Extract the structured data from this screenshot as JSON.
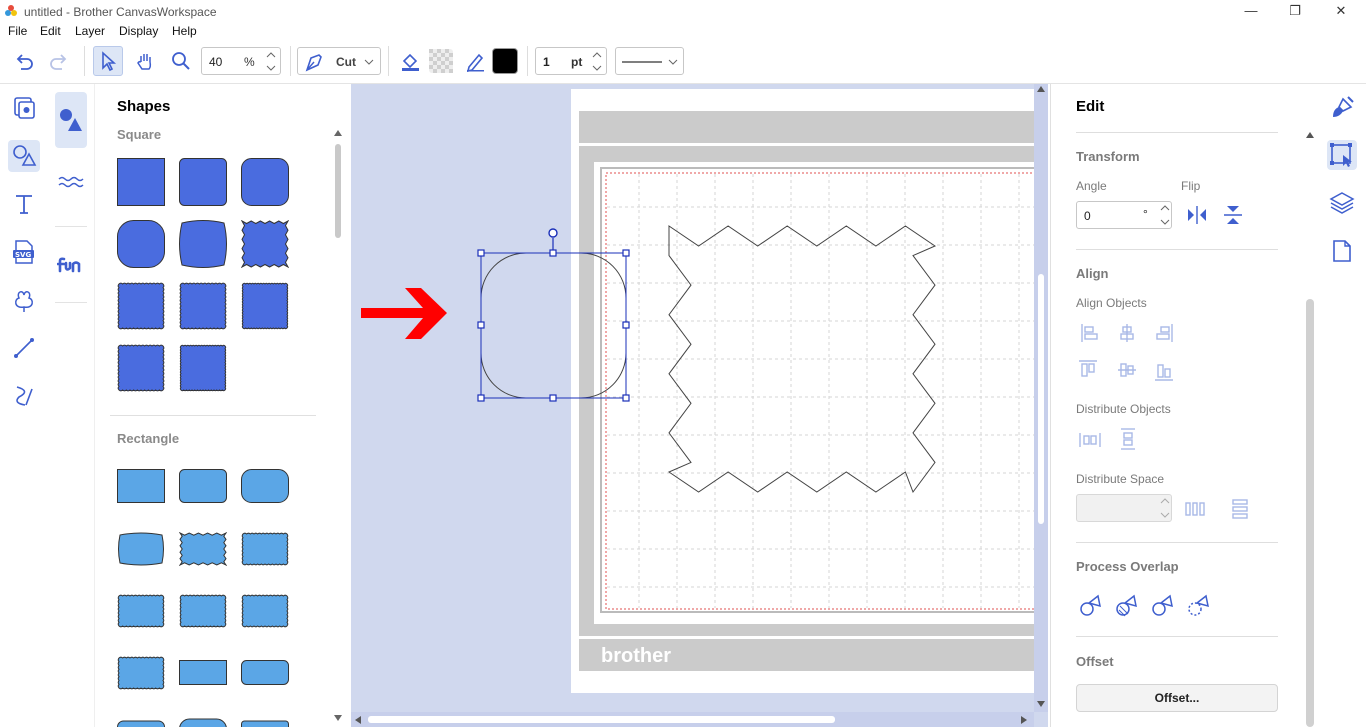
{
  "window": {
    "title": "untitled - Brother CanvasWorkspace"
  },
  "menu": [
    "File",
    "Edit",
    "Layer",
    "Display",
    "Help"
  ],
  "toolbar": {
    "zoom_value": "40",
    "zoom_unit": "%",
    "mode_value": "Cut",
    "line_width_value": "1",
    "line_width_unit": "pt",
    "stroke_color": "#000000"
  },
  "shapes_panel": {
    "title": "Shapes",
    "sections": {
      "square": "Square",
      "rectangle": "Rectangle"
    },
    "square_color": "#4a6cdf",
    "rectangle_color": "#5ba6e6"
  },
  "canvas": {
    "mat_brand": "brother",
    "arrow_color": "#ff0000"
  },
  "edit_panel": {
    "title": "Edit",
    "transform": {
      "heading": "Transform",
      "angle_label": "Angle",
      "angle_value": "0",
      "angle_unit": "°",
      "flip_label": "Flip"
    },
    "align": {
      "heading": "Align",
      "align_objects": "Align Objects",
      "distribute_objects": "Distribute Objects",
      "distribute_space": "Distribute Space"
    },
    "process_overlap": {
      "heading": "Process Overlap"
    },
    "offset": {
      "heading": "Offset",
      "button_label": "Offset..."
    }
  },
  "colors": {
    "accent": "#3f5fce",
    "selection": "#1a2fb8"
  }
}
